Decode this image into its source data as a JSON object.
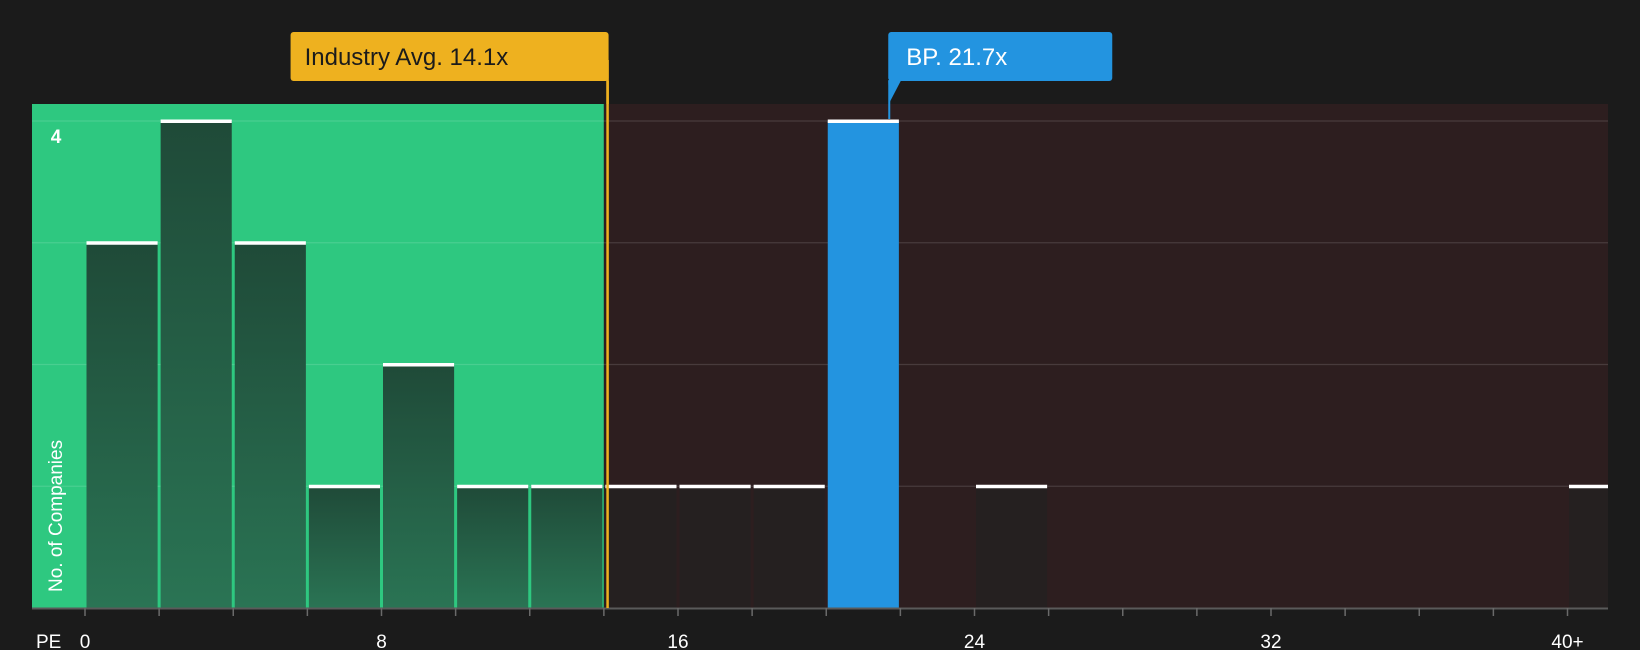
{
  "chart_data": {
    "type": "bar",
    "x_axis_label": "PE",
    "y_axis_label": "No. of Companies",
    "x_ticks": [
      "0",
      "8",
      "16",
      "24",
      "32",
      "40+"
    ],
    "x_tick_values": [
      0,
      8,
      16,
      24,
      32,
      40
    ],
    "y_tick_labels": [
      "4"
    ],
    "y_tick_values": [
      4
    ],
    "xlim": [
      0,
      41.5
    ],
    "ylim": [
      0,
      4.14
    ],
    "grid": true,
    "bin_width": 2,
    "bins": [
      {
        "x0": 0,
        "x1": 2,
        "count": 3
      },
      {
        "x0": 2,
        "x1": 4,
        "count": 4
      },
      {
        "x0": 4,
        "x1": 6,
        "count": 3
      },
      {
        "x0": 6,
        "x1": 8,
        "count": 1
      },
      {
        "x0": 8,
        "x1": 10,
        "count": 2
      },
      {
        "x0": 10,
        "x1": 12,
        "count": 1
      },
      {
        "x0": 12,
        "x1": 14,
        "count": 1
      },
      {
        "x0": 14,
        "x1": 16,
        "count": 1
      },
      {
        "x0": 16,
        "x1": 18,
        "count": 1
      },
      {
        "x0": 18,
        "x1": 20,
        "count": 1
      },
      {
        "x0": 20,
        "x1": 22,
        "count": 4,
        "highlight": true
      },
      {
        "x0": 24,
        "x1": 26,
        "count": 1
      },
      {
        "x0": 40,
        "x1": 42,
        "count": 1
      }
    ],
    "industry_avg": {
      "label": "Industry Avg. 14.1x",
      "value": 14.1
    },
    "company": {
      "label": "BP. 21.7x",
      "value": 21.7
    },
    "colors": {
      "background": "#1b1b1b",
      "below_avg_region": "#2ec880",
      "above_avg_region": "#2d1e1f",
      "bar_dark": "#214a38",
      "bar_neutral": "#252020",
      "highlight_bar": "#2394e0",
      "industry_callout": "#eeb11f",
      "company_callout": "#2394e0",
      "bar_cap": "#ffffff"
    }
  }
}
